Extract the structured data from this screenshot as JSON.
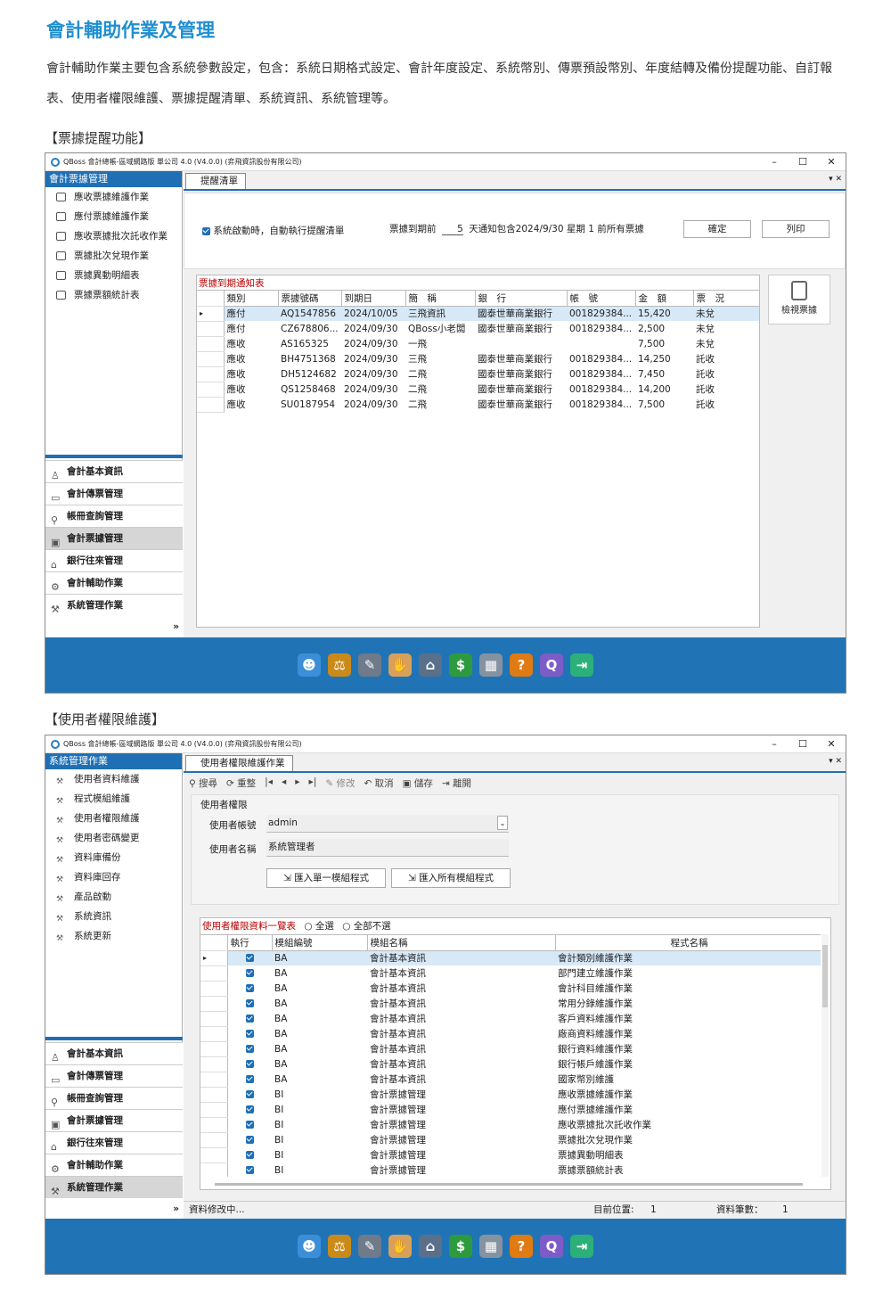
{
  "page": {
    "title": "會計輔助作業及管理",
    "intro": "會計輔助作業主要包含系統參數設定，包含：系統日期格式設定、會計年度設定、系統幣別、傳票預設幣別、年度結轉及備份提醒功能、自訂報表、使用者權限維護、票據提醒清單、系統資訊、系統管理等。",
    "section1": "【票據提醒功能】",
    "section2": "【使用者權限維護】"
  },
  "app": {
    "title": "QBoss 會計總帳-區域網路版 單公司 4.0 (V4.0.0) (弈飛資訊股份有限公司)",
    "minimize": "–",
    "maximize": "☐",
    "close": "✕",
    "nav": [
      {
        "label": "會計基本資訊",
        "icon": "person-icon",
        "glyph": "♙"
      },
      {
        "label": "會計傳票管理",
        "icon": "folder-icon",
        "glyph": "▭"
      },
      {
        "label": "帳冊查詢管理",
        "icon": "search-icon",
        "glyph": "⚲"
      },
      {
        "label": "會計票據管理",
        "icon": "ticket-icon",
        "glyph": "▣"
      },
      {
        "label": "銀行往來管理",
        "icon": "bank-icon",
        "glyph": "⌂"
      },
      {
        "label": "會計輔助作業",
        "icon": "gear-icon",
        "glyph": "⚙"
      },
      {
        "label": "系統管理作業",
        "icon": "tools-icon",
        "glyph": "⚒"
      }
    ],
    "more": "»"
  },
  "win1": {
    "sidebar_title": "會計票據管理",
    "items": [
      "應收票據維護作業",
      "應付票據維護作業",
      "應收票據批次託收作業",
      "票據批次兌現作業",
      "票據異動明細表",
      "票據票額統計表"
    ],
    "tab": "提醒清單",
    "pin": "▾ ✕",
    "startup_label": "系統啟動時，自動執行提醒清單",
    "due_before": "票據到期前",
    "days": "5",
    "days_suffix": "天通知包含2024/9/30 星期 1  前所有票據",
    "confirm": "確定",
    "print": "列印",
    "view_btn": "檢視票據",
    "grid_title": "票據到期通知表",
    "columns": [
      "類別",
      "票據號碼",
      "到期日",
      "簡　稱",
      "銀　行",
      "帳　號",
      "金　額",
      "票　況"
    ],
    "rows": [
      [
        "應付",
        "AQ1547856",
        "2024/10/05",
        "三飛資訊",
        "國泰世華商業銀行",
        "001829384...",
        "15,420",
        "未兌"
      ],
      [
        "應付",
        "CZ678806...",
        "2024/09/30",
        "QBoss小老闆",
        "國泰世華商業銀行",
        "001829384...",
        "2,500",
        "未兌"
      ],
      [
        "應收",
        "AS165325",
        "2024/09/30",
        "一飛",
        "",
        "",
        "7,500",
        "未兌"
      ],
      [
        "應收",
        "BH4751368",
        "2024/09/30",
        "三飛",
        "國泰世華商業銀行",
        "001829384...",
        "14,250",
        "託收"
      ],
      [
        "應收",
        "DH5124682",
        "2024/09/30",
        "二飛",
        "國泰世華商業銀行",
        "001829384...",
        "7,450",
        "託收"
      ],
      [
        "應收",
        "QS1258468",
        "2024/09/30",
        "二飛",
        "國泰世華商業銀行",
        "001829384...",
        "14,200",
        "託收"
      ],
      [
        "應收",
        "SU0187954",
        "2024/09/30",
        "二飛",
        "國泰世華商業銀行",
        "001829384...",
        "7,500",
        "託收"
      ]
    ]
  },
  "win2": {
    "sidebar_title": "系統管理作業",
    "items": [
      "使用者資料維護",
      "程式模組維護",
      "使用者權限維護",
      "使用者密碼變更",
      "資料庫備份",
      "資料庫回存",
      "產品啟動",
      "系統資訊",
      "系統更新"
    ],
    "tab": "使用者權限維護作業",
    "pin": "▾ ✕",
    "toolbar": {
      "search": "搜尋",
      "reset": "重整",
      "edit": "修改",
      "cancel": "取消",
      "save": "儲存",
      "exit": "離開"
    },
    "group_label": "使用者權限",
    "account_label": "使用者帳號",
    "account_value": "admin",
    "name_label": "使用者名稱",
    "name_value": "系統管理者",
    "import_single": "匯入單一模組程式",
    "import_all": "匯入所有模組程式",
    "grid_title": "使用者權限資料一覽表",
    "select_all": "全選",
    "select_none": "全部不選",
    "columns": [
      "執行",
      "模組編號",
      "模組名稱",
      "程式名稱"
    ],
    "rows": [
      [
        "BA",
        "會計基本資訊",
        "會計類別維護作業"
      ],
      [
        "BA",
        "會計基本資訊",
        "部門建立維護作業"
      ],
      [
        "BA",
        "會計基本資訊",
        "會計科目維護作業"
      ],
      [
        "BA",
        "會計基本資訊",
        "常用分錄維護作業"
      ],
      [
        "BA",
        "會計基本資訊",
        "客戶資料維護作業"
      ],
      [
        "BA",
        "會計基本資訊",
        "廠商資料維護作業"
      ],
      [
        "BA",
        "會計基本資訊",
        "銀行資料維護作業"
      ],
      [
        "BA",
        "會計基本資訊",
        "銀行帳戶維護作業"
      ],
      [
        "BA",
        "會計基本資訊",
        "國家幣別維護"
      ],
      [
        "BI",
        "會計票據管理",
        "應收票據維護作業"
      ],
      [
        "BI",
        "會計票據管理",
        "應付票據維護作業"
      ],
      [
        "BI",
        "會計票據管理",
        "應收票據批次託收作業"
      ],
      [
        "BI",
        "會計票據管理",
        "票據批次兌現作業"
      ],
      [
        "BI",
        "會計票據管理",
        "票據異動明細表"
      ],
      [
        "BI",
        "會計票據管理",
        "票據票額統計表"
      ]
    ],
    "status_left": "資料修改中...",
    "position_label": "目前位置:",
    "position_value": "1",
    "count_label": "資料筆數：",
    "count_value": "1"
  },
  "bottom_icons": [
    {
      "name": "owl-icon",
      "glyph": "☻",
      "color": "#3a8fd8"
    },
    {
      "name": "scale-icon",
      "glyph": "⚖",
      "color": "#c98a1a"
    },
    {
      "name": "pen-ticket-icon",
      "glyph": "✎",
      "color": "#6f7a8a"
    },
    {
      "name": "note-icon",
      "glyph": "✋",
      "color": "#d9a05a"
    },
    {
      "name": "bank-icon",
      "glyph": "⌂",
      "color": "#5a6f8a"
    },
    {
      "name": "cash-icon",
      "glyph": "$",
      "color": "#2e9a3e"
    },
    {
      "name": "calculator-icon",
      "glyph": "▦",
      "color": "#8592a0"
    },
    {
      "name": "help-icon",
      "glyph": "?",
      "color": "#e07a12"
    },
    {
      "name": "qboss-logo-icon",
      "glyph": "Q",
      "color": "#7d5cc7"
    },
    {
      "name": "exit-icon",
      "glyph": "⇥",
      "color": "#2bb07a"
    }
  ]
}
